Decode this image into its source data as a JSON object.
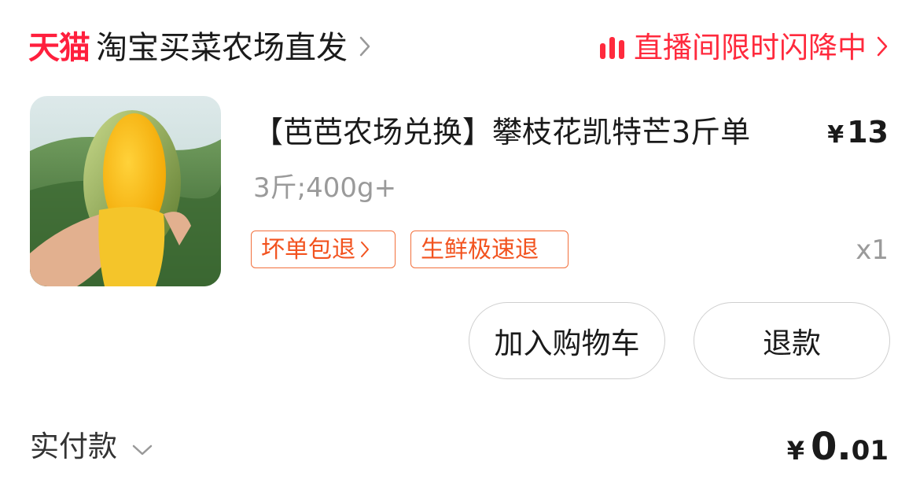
{
  "shop": {
    "brand": "天猫",
    "name": "淘宝买菜农场直发"
  },
  "live": {
    "label": "直播间限时闪降中"
  },
  "product": {
    "title": "【芭芭农场兑换】攀枝花凯特芒3斤单",
    "price_symbol": "¥",
    "price": "13",
    "sku": "3斤;400g+",
    "quantity": "x1",
    "tags": [
      "坏单包退",
      "生鲜极速退"
    ]
  },
  "actions": {
    "add_to_cart": "加入购物车",
    "refund": "退款"
  },
  "payment": {
    "label": "实付款",
    "currency": "¥",
    "amount_int": "0.",
    "amount_dec": "01"
  },
  "colors": {
    "brand_red": "#ff1f3d",
    "tag_orange": "#f2531f"
  }
}
